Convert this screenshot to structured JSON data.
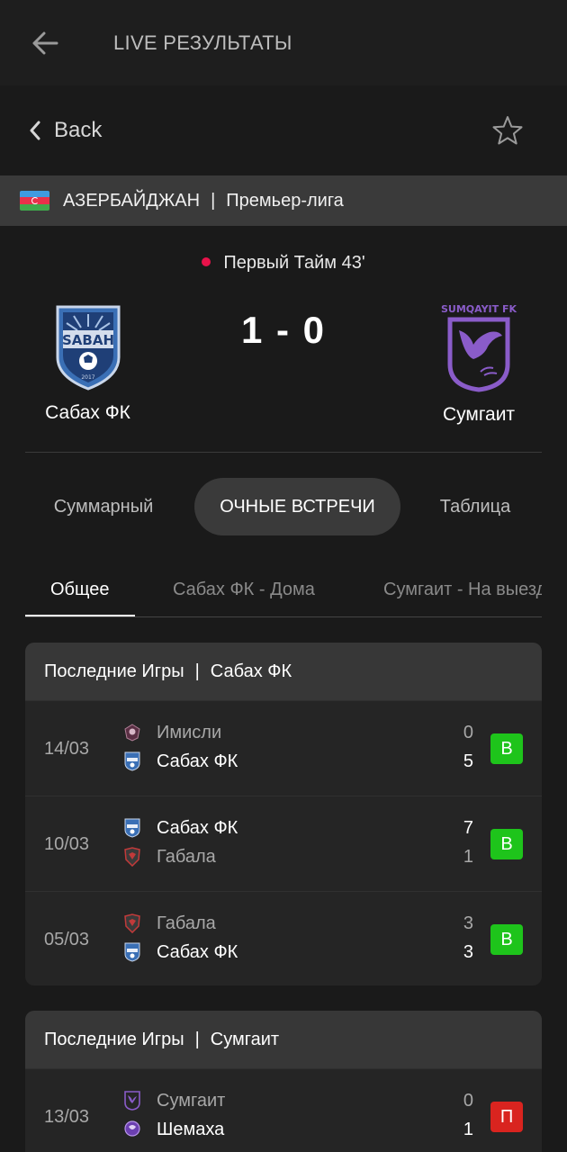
{
  "appbar": {
    "title": "LIVE РЕЗУЛЬТАТЫ",
    "back_icon": "arrow-left-icon"
  },
  "subbar": {
    "back_label": "Back",
    "star_icon": "star-icon"
  },
  "league": {
    "country": "АЗЕРБАЙДЖАН",
    "separator": "|",
    "competition": "Премьер-лига",
    "flag_colors": [
      "#3f9be0",
      "#e8314a",
      "#3fa94b"
    ]
  },
  "match": {
    "status": "Первый Тайм 43'",
    "live_dot_color": "#e8124a",
    "home": {
      "name": "Сабах ФК",
      "logo_text": "SABAH",
      "logo_badge": "2017",
      "logo_icon": "sabah-crest-icon"
    },
    "away": {
      "name": "Сумгаит",
      "logo_text": "SUMQAYIT FK",
      "logo_icon": "sumqayit-crest-icon"
    },
    "score": "1 - 0"
  },
  "tabs": [
    {
      "label": "Суммарный",
      "active": false
    },
    {
      "label": "ОЧНЫЕ ВСТРЕЧИ",
      "active": true
    },
    {
      "label": "Таблица",
      "active": false
    }
  ],
  "subtabs": [
    {
      "label": "Общее",
      "active": true
    },
    {
      "label": "Сабах ФК - Дома",
      "active": false
    },
    {
      "label": "Сумгаит - На выезде",
      "active": false
    }
  ],
  "sections": [
    {
      "title": "Последние Игры",
      "team": "Сабах ФК",
      "games": [
        {
          "date": "14/03",
          "t1": "Имисли",
          "t1_icon": "imishli-crest-icon",
          "g1": "0",
          "t2": "Сабах ФК",
          "t2_icon": "sabah-crest-icon",
          "g2": "5",
          "winner": 2,
          "result": "В"
        },
        {
          "date": "10/03",
          "t1": "Сабах ФК",
          "t1_icon": "sabah-crest-icon",
          "g1": "7",
          "t2": "Габала",
          "t2_icon": "gabala-crest-icon",
          "g2": "1",
          "winner": 1,
          "result": "В"
        },
        {
          "date": "05/03",
          "t1": "Габала",
          "t1_icon": "gabala-crest-icon",
          "g1": "3",
          "t2": "Сабах ФК",
          "t2_icon": "sabah-crest-icon",
          "g2": "3",
          "winner": 2,
          "result": "В"
        }
      ]
    },
    {
      "title": "Последние Игры",
      "team": "Сумгаит",
      "games": [
        {
          "date": "13/03",
          "t1": "Сумгаит",
          "t1_icon": "sumqayit-crest-icon",
          "g1": "0",
          "t2": "Шемаха",
          "t2_icon": "shamakhi-crest-icon",
          "g2": "1",
          "winner": 2,
          "result": "П"
        }
      ]
    }
  ],
  "colors": {
    "win_badge": "#1ec41b",
    "loss_badge": "#d9241f",
    "background": "#1a1a1a",
    "card": "#252525"
  }
}
